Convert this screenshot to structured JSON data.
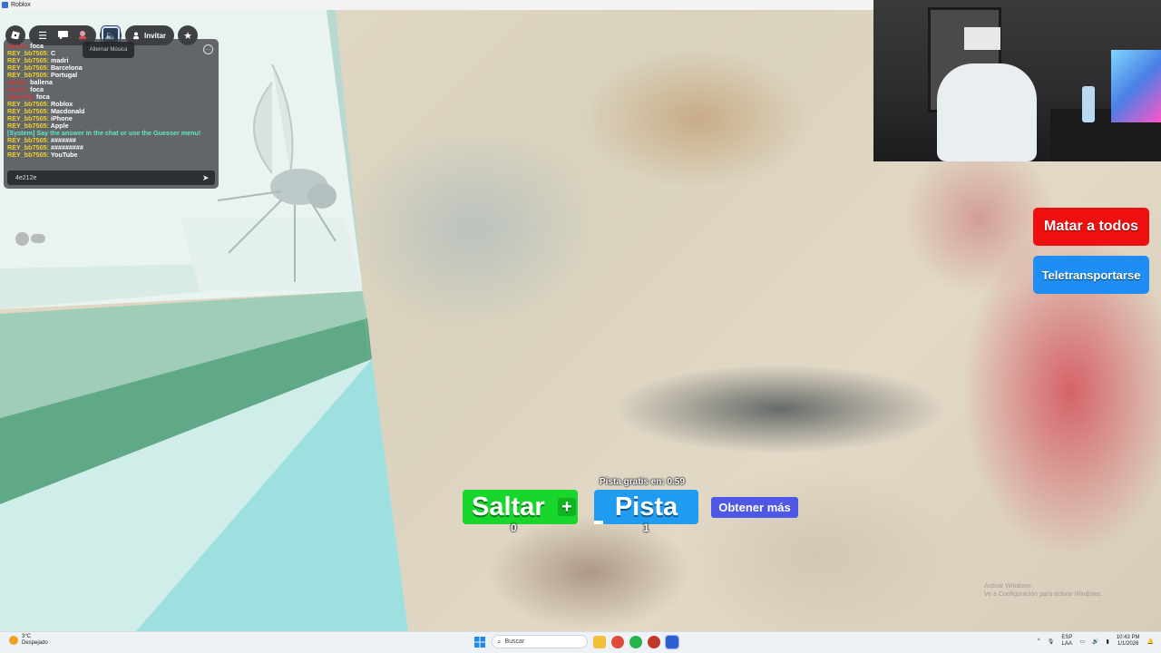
{
  "window": {
    "title": "Roblox"
  },
  "topbar": {
    "invite_label": "Invitar",
    "tooltip": "Alternar Música"
  },
  "chat": {
    "messages": [
      {
        "name": "abcde:",
        "text": "foca",
        "style": "red"
      },
      {
        "name": "REY_bb7505:",
        "text": "C",
        "style": "user"
      },
      {
        "name": "REY_bb7505:",
        "text": "madri",
        "style": "user"
      },
      {
        "name": "REY_bb7505:",
        "text": "Barcelona",
        "style": "user"
      },
      {
        "name": "REY_bb7505:",
        "text": "Portugal",
        "style": "user"
      },
      {
        "name": "abcde:",
        "text": "ballena",
        "style": "red"
      },
      {
        "name": "abcde:",
        "text": "foca",
        "style": "red"
      },
      {
        "name": "abcdefg:",
        "text": "foca",
        "style": "red"
      },
      {
        "name": "REY_bb7505:",
        "text": "Roblox",
        "style": "user"
      },
      {
        "name": "REY_bb7505:",
        "text": "Macdonald",
        "style": "user"
      },
      {
        "name": "REY_bb7505:",
        "text": "iPhone",
        "style": "user"
      },
      {
        "name": "REY_bb7505:",
        "text": "Apple",
        "style": "user"
      },
      {
        "name": "[System]",
        "text": "Say the answer in the chat or use the Guesser menu!",
        "style": "system"
      },
      {
        "name": "REY_bb7505:",
        "text": "#######",
        "style": "user"
      },
      {
        "name": "REY_bb7505:",
        "text": "#########",
        "style": "user"
      },
      {
        "name": "REY_bb7505:",
        "text": "YouTube",
        "style": "user"
      }
    ],
    "input_value": "4e212e"
  },
  "game": {
    "kill_all_label": "Matar a todos",
    "teleport_label": "Teletransportarse",
    "free_hint_label": "Pista gratis en: 0.59",
    "jump_label": "Saltar",
    "jump_plus": "+",
    "jump_count": "0",
    "hint_label": "Pista",
    "hint_count": "1",
    "get_more_label": "Obtener más"
  },
  "watermark": {
    "line1": "Activar Windows",
    "line2": "Ve a Configuración para activar Windows."
  },
  "taskbar": {
    "weather_temp": "3°C",
    "weather_desc": "Despejado",
    "search_placeholder": "Buscar",
    "lang_top": "ESP",
    "lang_bottom": "LAA",
    "time": "10:43 PM",
    "date": "1/1/2026"
  },
  "colors": {
    "kill_button": "#ee1010",
    "teleport_button": "#1e8ef4",
    "jump_button": "#19d62c",
    "hint_button": "#1f9bf0",
    "more_button": "#4e57e6"
  }
}
